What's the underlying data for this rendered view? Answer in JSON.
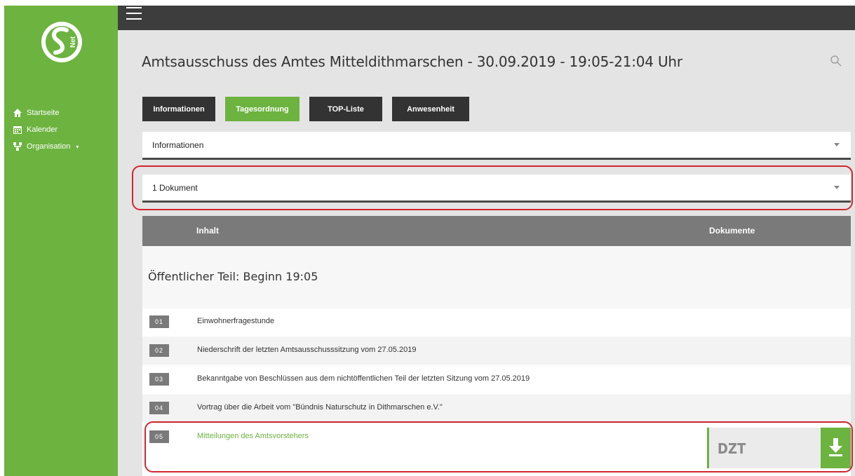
{
  "sidebar": {
    "logo_text": "S Net",
    "items": [
      {
        "label": "Startseite",
        "icon": "home-icon"
      },
      {
        "label": "Kalender",
        "icon": "calendar-icon"
      },
      {
        "label": "Organisation",
        "icon": "organisation-icon",
        "caret": "▾"
      }
    ]
  },
  "header": {
    "title": "Amtsausschuss des Amtes Mitteldithmarschen - 30.09.2019 - 19:05-21:04 Uhr",
    "search_icon": "search-icon"
  },
  "tabs": [
    {
      "label": "Informationen",
      "active": false
    },
    {
      "label": "Tagesordnung",
      "active": true
    },
    {
      "label": "TOP-Liste",
      "active": false
    },
    {
      "label": "Anwesenheit",
      "active": false
    }
  ],
  "accordions": [
    {
      "label": "Informationen"
    },
    {
      "label": "1 Dokument"
    }
  ],
  "table": {
    "headers": {
      "content": "Inhalt",
      "documents": "Dokumente"
    },
    "section_title": "Öffentlicher Teil: Beginn 19:05",
    "rows": [
      {
        "num": "01",
        "text": "Einwohnerfragestunde"
      },
      {
        "num": "02",
        "text": "Niederschrift der letzten Amtsausschusssitzung vom 27.05.2019"
      },
      {
        "num": "03",
        "text": "Bekanntgabe von Beschlüssen aus dem nichtöffentlichen Teil der letzten Sitzung vom 27.05.2019"
      },
      {
        "num": "04",
        "text": "Vortrag über die Arbeit vom \"Bündnis Naturschutz in Dithmarschen e.V.\""
      },
      {
        "num": "05",
        "text": "Mitteilungen des Amtsvorstehers"
      }
    ]
  },
  "document": {
    "label": "DZT",
    "download_icon": "download-icon"
  },
  "colors": {
    "brand_green": "#6cb33f",
    "dark_bar": "#3d3d3d",
    "highlight_red": "#d1262e"
  }
}
